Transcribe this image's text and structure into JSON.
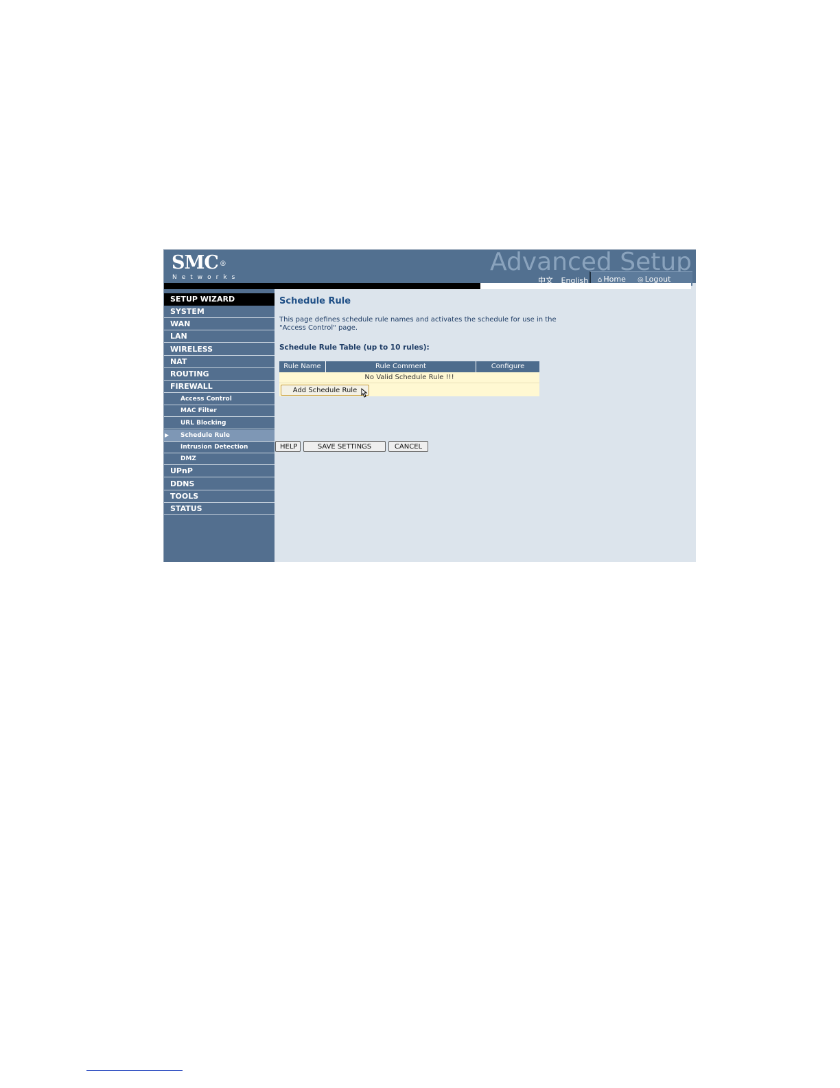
{
  "header": {
    "logo": "SMC",
    "logo_reg": "®",
    "logo_sub": "Networks",
    "title": "Advanced Setup",
    "lang_cn": "中文",
    "lang_en": "English",
    "home": "Home",
    "logout": "Logout"
  },
  "sidebar": {
    "items": [
      {
        "label": "SETUP WIZARD"
      },
      {
        "label": "SYSTEM"
      },
      {
        "label": "WAN"
      },
      {
        "label": "LAN"
      },
      {
        "label": "WIRELESS"
      },
      {
        "label": "NAT"
      },
      {
        "label": "ROUTING"
      },
      {
        "label": "FIREWALL"
      },
      {
        "label": "Access Control"
      },
      {
        "label": "MAC Filter"
      },
      {
        "label": "URL Blocking"
      },
      {
        "label": "Schedule Rule"
      },
      {
        "label": "Intrusion Detection"
      },
      {
        "label": "DMZ"
      },
      {
        "label": "UPnP"
      },
      {
        "label": "DDNS"
      },
      {
        "label": "TOOLS"
      },
      {
        "label": "STATUS"
      }
    ]
  },
  "main": {
    "title": "Schedule Rule",
    "description": "This page defines schedule rule names and activates the schedule for use in the \"Access Control\" page.",
    "table_title": "Schedule Rule Table (up to 10 rules):",
    "columns": [
      "Rule Name",
      "Rule Comment",
      "Configure"
    ],
    "empty_text": "No Valid Schedule Rule !!!",
    "add_button": "Add Schedule Rule"
  },
  "footer_buttons": {
    "help": "HELP",
    "save": "SAVE SETTINGS",
    "cancel": "CANCEL"
  }
}
